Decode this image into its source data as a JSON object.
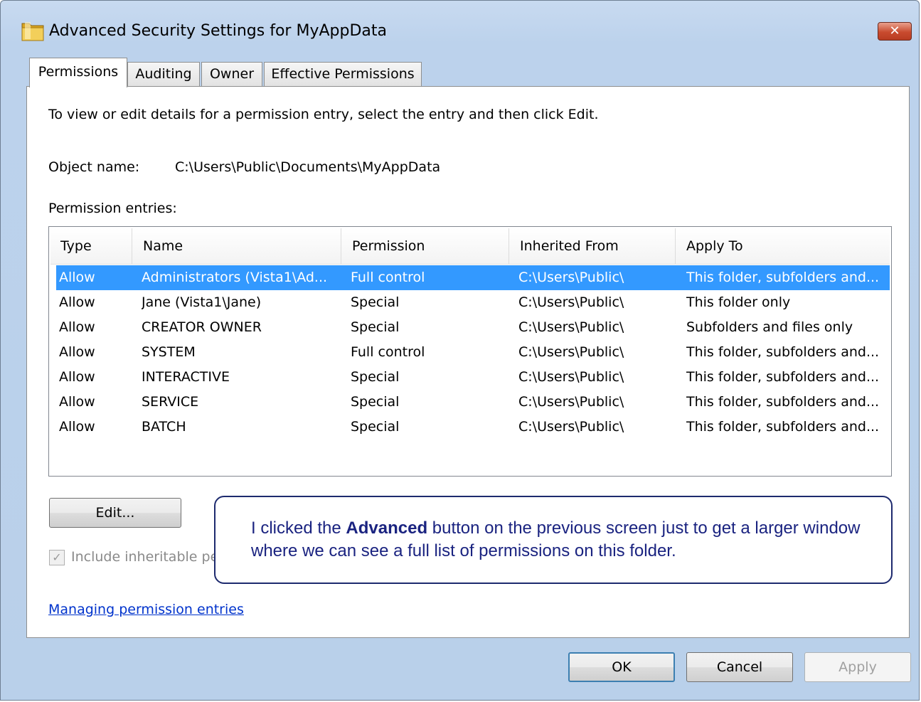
{
  "window": {
    "title": "Advanced Security Settings for MyAppData",
    "close_label": "✕"
  },
  "tabs": [
    {
      "label": "Permissions",
      "active": true
    },
    {
      "label": "Auditing",
      "active": false
    },
    {
      "label": "Owner",
      "active": false
    },
    {
      "label": "Effective Permissions",
      "active": false
    }
  ],
  "panel": {
    "instruction": "To view or edit details for a permission entry, select the entry and then click Edit.",
    "object_name_label": "Object name:",
    "object_name_value": "C:\\Users\\Public\\Documents\\MyAppData",
    "entries_label": "Permission entries:"
  },
  "table": {
    "columns": [
      "Type",
      "Name",
      "Permission",
      "Inherited From",
      "Apply To"
    ],
    "rows": [
      {
        "type": "Allow",
        "name": "Administrators (Vista1\\Ad...",
        "permission": "Full control",
        "inherited": "C:\\Users\\Public\\",
        "apply": "This folder, subfolders and...",
        "selected": true
      },
      {
        "type": "Allow",
        "name": "Jane (Vista1\\Jane)",
        "permission": "Special",
        "inherited": "C:\\Users\\Public\\",
        "apply": "This folder only",
        "selected": false
      },
      {
        "type": "Allow",
        "name": "CREATOR OWNER",
        "permission": "Special",
        "inherited": "C:\\Users\\Public\\",
        "apply": "Subfolders and files only",
        "selected": false
      },
      {
        "type": "Allow",
        "name": "SYSTEM",
        "permission": "Full control",
        "inherited": "C:\\Users\\Public\\",
        "apply": "This folder, subfolders and...",
        "selected": false
      },
      {
        "type": "Allow",
        "name": "INTERACTIVE",
        "permission": "Special",
        "inherited": "C:\\Users\\Public\\",
        "apply": "This folder, subfolders and...",
        "selected": false
      },
      {
        "type": "Allow",
        "name": "SERVICE",
        "permission": "Special",
        "inherited": "C:\\Users\\Public\\",
        "apply": "This folder, subfolders and...",
        "selected": false
      },
      {
        "type": "Allow",
        "name": "BATCH",
        "permission": "Special",
        "inherited": "C:\\Users\\Public\\",
        "apply": "This folder, subfolders and...",
        "selected": false
      }
    ]
  },
  "buttons": {
    "edit": "Edit...",
    "ok": "OK",
    "cancel": "Cancel",
    "apply": "Apply"
  },
  "checkbox": {
    "label": "Include inheritable pe",
    "checked": true
  },
  "callout": {
    "before": "I clicked the ",
    "bold": "Advanced",
    "after": " button on the previous screen just to get a larger window where we can see a full list of permissions on this folder."
  },
  "link": "Managing permission entries",
  "colors": {
    "selection": "#3399ff",
    "callout_border": "#1d2a6e",
    "callout_text": "#1a2380",
    "link": "#0033cc"
  }
}
